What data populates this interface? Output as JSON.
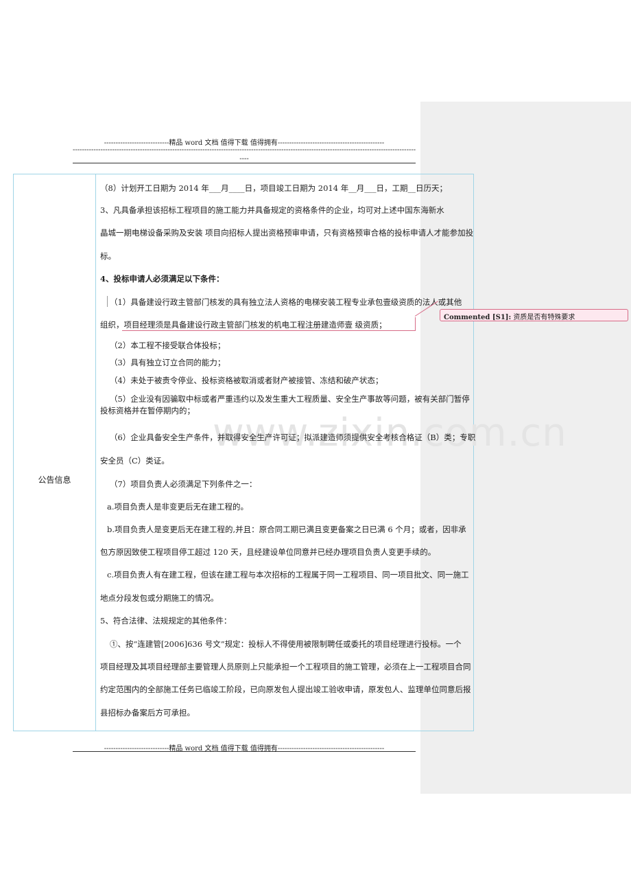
{
  "header": {
    "line1": "----------------------------精品 word 文档  值得下载  值得拥有----------------------------------------------",
    "line2": "----------------------------------------------------------------------------------------------------------------------------------------------------------",
    "line3": "----"
  },
  "table": {
    "label": "公告信息",
    "lines": {
      "l1": "（8）计划开工日期为 2014 年___月____日，项目竣工日期为 2014  年__月___日，工期__日历天；",
      "l2": "3、凡具备承担该招标工程项目的施工能力并具备规定的资格条件的企业，均可对上述中国东海新水",
      "l3": "晶城一期电梯设备采购及安装  项目向招标人提出资格预审申请，只有资格预审合格的投标申请人才能参加投",
      "l4": "标。",
      "l5": "4、投标申请人必须满足以下条件：",
      "l6": "（1）具备建设行政主管部门核发的具有独立法人资格的电梯安装工程专业承包壹级资质的法人或其他",
      "l7": "组织，项目经理须是具备建设行政主管部门核发的机电工程注册建造师壹  级资质；",
      "l8": "（2）本工程不接受联合体投标；",
      "l9": "（3）具有独立订立合同的能力；",
      "l10": "（4）未处于被责令停业、投标资格被取消或者财产被接管、冻结和破产状态；",
      "l11": "（5）企业没有因骗取中标或者严重违约以及发生重大工程质量、安全生产事故等问题，被有关部门暂停",
      "l12": "投标资格并在暂停期内的；",
      "l13": "（6）企业具备安全生产条件，并取得安全生产许可证；拟派建造师须提供安全考核合格证（B）类；专职",
      "l14": "安全员（C）类证。",
      "l15": "（7）项目负责人必须满足下列条件之一：",
      "l16": "a.项目负责人是非变更后无在建工程的。",
      "l17": "b.项目负责人是变更后无在建工程的,并且：原合同工期已满且变更备案之日已满 6 个月；或者，因非承",
      "l18": "包方原因致使工程项目停工超过 120 天，且经建设单位同意并已经办理项目负责人变更手续的。",
      "l19": "c.项目负责人有在建工程，但该在建工程与本次招标的工程属于同一工程项目、同一项目批文、同一施工",
      "l20": "地点分段发包或分期施工的情况。",
      "l21": "5、符合法律、法规规定的其他条件：",
      "l22": "①、按“连建管[2006]636 号文”规定：投标人不得使用被限制聘任或委托的项目经理进行投标。一个",
      "l23": "项目经理及其项目经理部主要管理人员原则上只能承担一个工程项目的施工管理，必须在上一工程项目合同",
      "l24": "约定范围内的全部施工任务已临竣工阶段，已向原发包人提出竣工验收申请，原发包人、监理单位同意后报",
      "l25": "县招标办备案后方可承担。"
    }
  },
  "comment": {
    "author": "Commented [S1]:",
    "text": "资质是否有特殊要求"
  },
  "watermark": "www.zixin.com.cn",
  "footer": {
    "line": "----------------------------精品 word 文档  值得下载  值得拥有----------------------------------------------"
  }
}
